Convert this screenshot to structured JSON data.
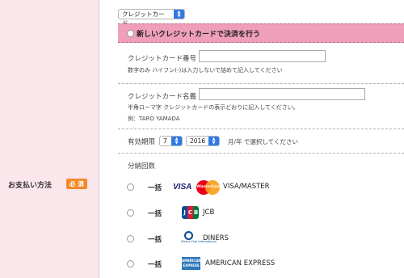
{
  "row": {
    "label": "お支払い方法",
    "required_badge": "必 須"
  },
  "card_type_select": {
    "value": "クレジットカード"
  },
  "new_card_option": {
    "label": "新しいクレジットカードで決済を行う"
  },
  "card_number": {
    "label": "クレジットカード番号",
    "value": "",
    "hint": "数字のみ ハイフン(-)は入力しないで詰めて記入してください"
  },
  "card_name": {
    "label": "クレジットカード名義",
    "value": "",
    "hint": "半角ローマ字 クレジットカードの表示どおりに記入してください。",
    "example": "例：TARO YAMADA"
  },
  "expiry": {
    "label": "有効期限",
    "month": "7",
    "year": "2016",
    "suffix": "月/年 で選択してください"
  },
  "installments": {
    "label": "分納回数"
  },
  "payment_options": [
    {
      "label": "一括",
      "brand": "VISA/MASTER",
      "icons": [
        "visa-icon",
        "mastercard-icon"
      ]
    },
    {
      "label": "一括",
      "brand": "JCB",
      "icons": [
        "jcb-icon"
      ]
    },
    {
      "label": "一括",
      "brand": "DINERS",
      "icons": [
        "diners-club-icon"
      ]
    },
    {
      "label": "一括",
      "brand": "AMERICAN EXPRESS",
      "icons": [
        "amex-icon"
      ]
    }
  ],
  "logos": {
    "visa": "VISA",
    "mastercard": "MasterCard",
    "jcb": [
      "J",
      "C",
      "B"
    ],
    "diners": "Diners Club International",
    "amex": "AMERICAN EXPRESS"
  },
  "colors": {
    "left_column_bg": "#fbe6ec",
    "selected_band_bg": "#ef9fb9",
    "required_badge_bg": "#f08a2a",
    "select_arrow_bg": "#2f7ae5"
  }
}
